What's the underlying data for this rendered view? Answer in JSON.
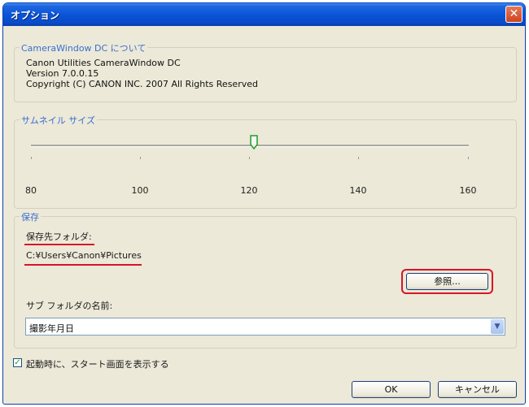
{
  "window": {
    "title": "オプション"
  },
  "about": {
    "legend": "CameraWindow DC について",
    "lines": [
      "Canon Utilities CameraWindow DC",
      "Version 7.0.0.15",
      "Copyright (C) CANON INC. 2007 All Rights Reserved"
    ]
  },
  "thumbnail": {
    "legend": "サムネイル サイズ",
    "labels": [
      "80",
      "100",
      "120",
      "140",
      "160"
    ],
    "value": 120,
    "min": 80,
    "max": 160
  },
  "save": {
    "legend": "保存",
    "folder_label": "保存先フォルダ:",
    "folder_path": "C:¥Users¥Canon¥Pictures",
    "browse_label": "参照...",
    "subfolder_label": "サブ フォルダの名前:",
    "subfolder_value": "撮影年月日"
  },
  "startup": {
    "label": "起動時に、スタート画面を表示する",
    "checked": true
  },
  "buttons": {
    "ok": "OK",
    "cancel": "キャンセル"
  },
  "colors": {
    "title_bar": "#0a55d8",
    "highlight": "#d8142a",
    "legend_text": "#3a6ed0"
  }
}
